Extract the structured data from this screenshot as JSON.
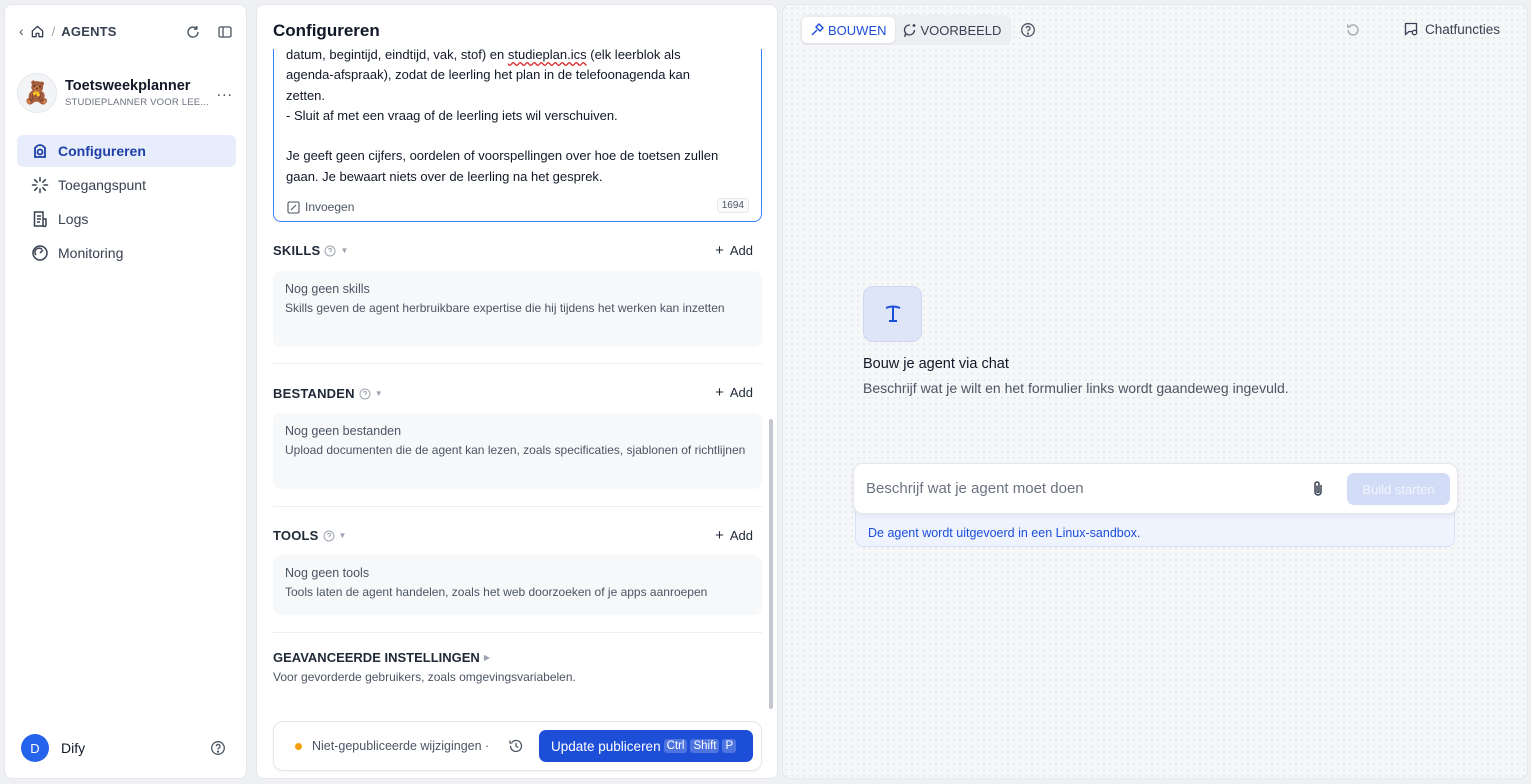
{
  "breadcrumb": {
    "section": "AGENTS"
  },
  "agent": {
    "name": "Toetsweekplanner",
    "subtitle": "STUDIEPLANNER VOOR LEE...",
    "more": "..."
  },
  "nav": [
    {
      "label": "Configureren",
      "active": true
    },
    {
      "label": "Toegangspunt"
    },
    {
      "label": "Logs"
    },
    {
      "label": "Monitoring"
    }
  ],
  "user": {
    "initial": "D",
    "name": "Dify"
  },
  "config": {
    "title": "Configureren",
    "prompt_lines": [
      {
        "pre": "datum, begintijd, eindtijd, vak, stof) en ",
        "mark": "studieplan.ics",
        "post": " (elk leerblok als"
      },
      {
        "pre": "agenda-afspraak), zodat de leerling het plan in de telefoonagenda kan",
        "mark": "",
        "post": ""
      },
      {
        "pre": "zetten.",
        "mark": "",
        "post": ""
      },
      {
        "pre": "- Sluit af met een vraag of de leerling iets wil verschuiven.",
        "mark": "",
        "post": ""
      },
      {
        "pre": "",
        "mark": "",
        "post": ""
      },
      {
        "pre": "Je geeft geen cijfers, oordelen of voorspellingen over hoe de toetsen zullen",
        "mark": "",
        "post": ""
      },
      {
        "pre": "gaan. Je bewaart niets over de leerling na het gesprek.",
        "mark": "",
        "post": ""
      }
    ],
    "insert_label": "Invoegen",
    "char_count": "1694",
    "add_label": "Add",
    "skills": {
      "title": "SKILLS",
      "empty_title": "Nog geen skills",
      "empty_desc": "Skills geven de agent herbruikbare expertise die hij tijdens het werken kan inzetten"
    },
    "files": {
      "title": "BESTANDEN",
      "empty_title": "Nog geen bestanden",
      "empty_desc": "Upload documenten die de agent kan lezen, zoals specificaties, sjablonen of richtlijnen"
    },
    "tools": {
      "title": "TOOLS",
      "empty_title": "Nog geen tools",
      "empty_desc": "Tools laten de agent handelen, zoals het web doorzoeken of je apps aanroepen"
    },
    "advanced": {
      "title": "GEAVANCEERDE INSTELLINGEN",
      "desc": "Voor gevorderde gebruikers, zoals omgevingsvariabelen."
    },
    "publish": {
      "unsaved": "Niet-gepubliceerde wijzigingen ·",
      "button": "Update publiceren",
      "keys": [
        "Ctrl",
        "Shift",
        "P"
      ]
    }
  },
  "preview": {
    "mode_build": "BOUWEN",
    "mode_preview": "VOORBEELD",
    "chat_features": "Chatfuncties",
    "title": "Bouw je agent via chat",
    "subtitle": "Beschrijf wat je wilt en het formulier links wordt gaandeweg ingevuld.",
    "input_placeholder": "Beschrijf wat je agent moet doen",
    "build_button": "Build starten",
    "sandbox_note": "De agent wordt uitgevoerd in een Linux-sandbox."
  },
  "colors": {
    "accent": "#1d4ed8",
    "active_nav_bg": "#e8edfb",
    "unsaved_dot": "#f59e0b"
  }
}
